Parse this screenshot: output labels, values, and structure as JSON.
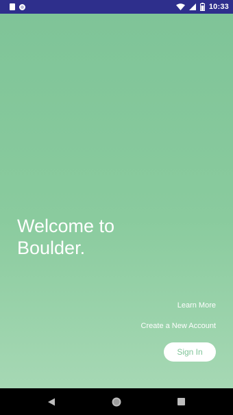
{
  "status_bar": {
    "time": "10:33",
    "icons": [
      "sim-card-icon",
      "circle-notification-icon",
      "wifi-icon",
      "cell-signal-icon",
      "battery-icon"
    ]
  },
  "welcome": {
    "line1": "Welcome to",
    "line2": "Boulder."
  },
  "links": {
    "learn_more": "Learn More",
    "create_account": "Create a New Account"
  },
  "buttons": {
    "sign_in": "Sign In"
  },
  "colors": {
    "status_bar": "#2e2f8c",
    "gradient_top": "#7fc498",
    "gradient_bottom": "#a6d8b4",
    "text": "#ffffff",
    "button_bg": "#ffffff",
    "button_text": "#7fc498",
    "nav_bar": "#000000"
  },
  "nav": {
    "items": [
      "back-icon",
      "home-icon",
      "recents-icon"
    ]
  }
}
